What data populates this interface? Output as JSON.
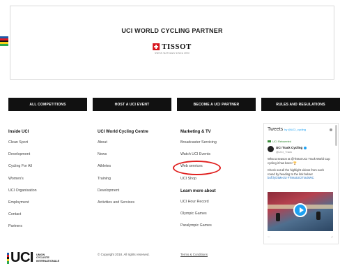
{
  "partner": {
    "title": "UCI WORLD CYCLING PARTNER",
    "brand": "TISSOT",
    "tagline": "SWISS WATCHES SINCE 1853"
  },
  "colors": {
    "rainbow": [
      "#1e5aa8",
      "#e31b23",
      "#111111",
      "#f7d117",
      "#2fa84f"
    ],
    "highlight": "#e0201f",
    "button_bg": "#111111"
  },
  "actions": [
    "ALL COMPETITIONS",
    "HOST A UCI EVENT",
    "BECOME A UCI PARTNER",
    "RULES AND REGULATIONS"
  ],
  "columns": {
    "inside": {
      "title": "Inside UCI",
      "links": [
        "Clean Sport",
        "Development",
        "Cycling For All",
        "Women's",
        "UCI Organisation",
        "Employment",
        "Contact",
        "Partners"
      ]
    },
    "centre": {
      "title": "UCI World Cycling Centre",
      "links": [
        "About",
        "News",
        "Athletes",
        "Training",
        "Development",
        "Activities and Services"
      ]
    },
    "marketing": {
      "title": "Marketing & TV",
      "links": [
        "Broadcaster Servicing",
        "Watch UCI Events",
        "Web services",
        "UCI Shop"
      ],
      "subtitle": "Learn more about",
      "more_links": [
        "UCI Hour Record",
        "Olympic Games",
        "Paralympic Games"
      ]
    }
  },
  "tweets": {
    "header": "Tweets",
    "by": "by @UCI_cycling",
    "retweeted": "UCI Retweeted",
    "name": "UCI Track Cycling",
    "handle": "@UCI_Track",
    "text1": "What a season at @Tissot UCI Track World Cup cycling it has been! 🏆",
    "text2": "Check out all the highlight videos from each round by heading to the link below!",
    "link": "buff.ly/2tMeciU #TissotUCITrackWC"
  },
  "footer": {
    "logo": "UCI",
    "logo_sub": [
      "UNION",
      "CYCLISTE",
      "INTERNATIONALE"
    ],
    "copyright": "© Copyright 2018. All rights reserved.",
    "terms": "Terms & Conditions"
  }
}
